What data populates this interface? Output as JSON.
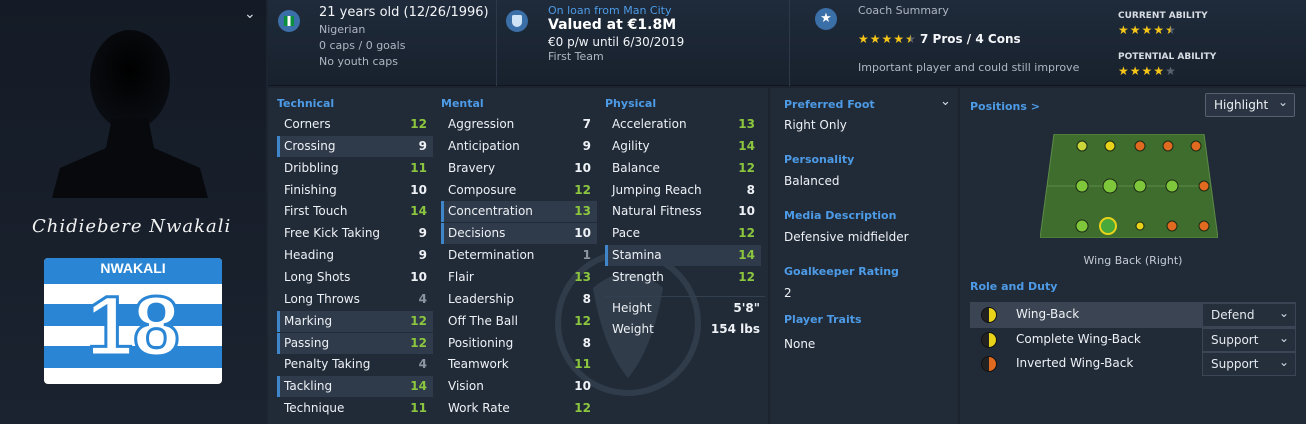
{
  "player": {
    "signature": "Chidiebere Nwakali",
    "shirt_name": "NWAKALI",
    "shirt_number": "18"
  },
  "info": {
    "age_line": "21 years old (12/26/1996)",
    "nationality": "Nigerian",
    "caps": "0 caps / 0 goals",
    "youth_caps": "No youth caps"
  },
  "contract": {
    "loan": "On loan from Man City",
    "value": "Valued at €1.8M",
    "wage": "€0 p/w until 6/30/2019",
    "squad": "First Team"
  },
  "coach": {
    "title": "Coach Summary",
    "pros_cons": "7 Pros / 4 Cons",
    "summary": "Important player and could still improve",
    "pros_stars": 4.5,
    "current_label": "CURRENT ABILITY",
    "current_stars": 4.5,
    "potential_label": "POTENTIAL ABILITY",
    "potential_stars": 4
  },
  "technical": {
    "header": "Technical",
    "attrs": [
      {
        "name": "Corners",
        "value": "12"
      },
      {
        "name": "Crossing",
        "value": "9"
      },
      {
        "name": "Dribbling",
        "value": "11"
      },
      {
        "name": "Finishing",
        "value": "10"
      },
      {
        "name": "First Touch",
        "value": "14"
      },
      {
        "name": "Free Kick Taking",
        "value": "9"
      },
      {
        "name": "Heading",
        "value": "9"
      },
      {
        "name": "Long Shots",
        "value": "10"
      },
      {
        "name": "Long Throws",
        "value": "4"
      },
      {
        "name": "Marking",
        "value": "12"
      },
      {
        "name": "Passing",
        "value": "12"
      },
      {
        "name": "Penalty Taking",
        "value": "4"
      },
      {
        "name": "Tackling",
        "value": "14"
      },
      {
        "name": "Technique",
        "value": "11"
      }
    ]
  },
  "mental": {
    "header": "Mental",
    "attrs": [
      {
        "name": "Aggression",
        "value": "7"
      },
      {
        "name": "Anticipation",
        "value": "9"
      },
      {
        "name": "Bravery",
        "value": "10"
      },
      {
        "name": "Composure",
        "value": "12"
      },
      {
        "name": "Concentration",
        "value": "13"
      },
      {
        "name": "Decisions",
        "value": "10"
      },
      {
        "name": "Determination",
        "value": "1"
      },
      {
        "name": "Flair",
        "value": "13"
      },
      {
        "name": "Leadership",
        "value": "8"
      },
      {
        "name": "Off The Ball",
        "value": "12"
      },
      {
        "name": "Positioning",
        "value": "8"
      },
      {
        "name": "Teamwork",
        "value": "11"
      },
      {
        "name": "Vision",
        "value": "10"
      },
      {
        "name": "Work Rate",
        "value": "12"
      }
    ]
  },
  "physical": {
    "header": "Physical",
    "attrs": [
      {
        "name": "Acceleration",
        "value": "13"
      },
      {
        "name": "Agility",
        "value": "14"
      },
      {
        "name": "Balance",
        "value": "12"
      },
      {
        "name": "Jumping Reach",
        "value": "8"
      },
      {
        "name": "Natural Fitness",
        "value": "10"
      },
      {
        "name": "Pace",
        "value": "12"
      },
      {
        "name": "Stamina",
        "value": "14"
      },
      {
        "name": "Strength",
        "value": "12"
      }
    ],
    "height_label": "Height",
    "height": "5'8\"",
    "weight_label": "Weight",
    "weight": "154 lbs"
  },
  "details": {
    "foot_label": "Preferred Foot",
    "foot": "Right Only",
    "personality_label": "Personality",
    "personality": "Balanced",
    "media_label": "Media Description",
    "media": "Defensive midfielder",
    "gk_label": "Goalkeeper Rating",
    "gk": "2",
    "traits_label": "Player Traits",
    "traits": "None"
  },
  "positions": {
    "header": "Positions >",
    "highlight": "Highlight",
    "caption": "Wing Back (Right)"
  },
  "roles": {
    "header": "Role and Duty",
    "items": [
      {
        "name": "Wing-Back",
        "duty": "Defend"
      },
      {
        "name": "Complete Wing-Back",
        "duty": "Support"
      },
      {
        "name": "Inverted Wing-Back",
        "duty": "Support"
      }
    ]
  },
  "colors": {
    "accent": "#4d9be6",
    "good": "#8cc63f",
    "star": "#f5c518"
  }
}
